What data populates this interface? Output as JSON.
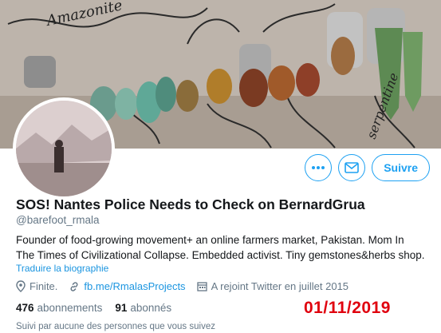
{
  "banner": {
    "handwriting": [
      "Amazonite",
      "serpentine"
    ]
  },
  "actions": {
    "more_icon": "more-dots-icon",
    "message_icon": "envelope-icon",
    "follow_label": "Suivre"
  },
  "profile": {
    "name": "SOS! Nantes Police Needs to Check on BernardGrua",
    "handle": "@barefoot_rmala",
    "bio_line1": "Founder of food-growing movement+ an online farmers market, Pakistan. Mom In",
    "bio_line2": "The Times of Civilizational Collapse. Embedded activist. Tiny gemstones&herbs shop.",
    "translate_label": "Traduire la biographie",
    "location": "Finite.",
    "website": "fb.me/RmalasProjects",
    "joined": "A rejoint Twitter en juillet 2015"
  },
  "stats": {
    "following_count": "476",
    "following_label": "abonnements",
    "followers_count": "91",
    "followers_label": "abonnés"
  },
  "annotation": {
    "date": "01/11/2019"
  },
  "followed_by": "Suivi par aucune des personnes que vous suivez",
  "colors": {
    "accent": "#1da1f2",
    "link": "#1b95e0",
    "annotation_red": "#e0000e",
    "muted": "#657786"
  }
}
